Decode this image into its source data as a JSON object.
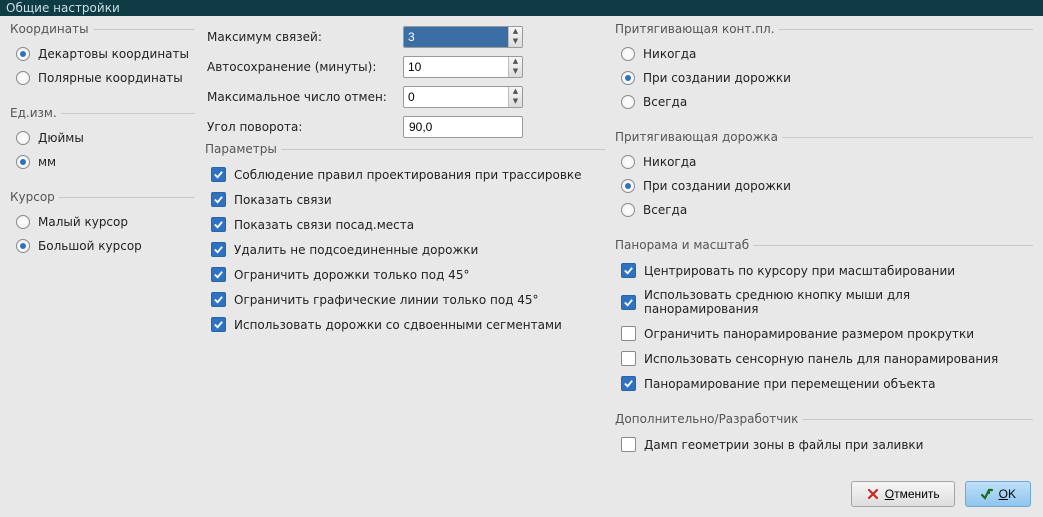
{
  "window": {
    "title": "Общие настройки"
  },
  "coords": {
    "legend": "Координаты",
    "options": [
      {
        "label": "Декартовы координаты",
        "checked": true
      },
      {
        "label": "Полярные координаты",
        "checked": false
      }
    ]
  },
  "units": {
    "legend": "Ед.изм.",
    "options": [
      {
        "label": "Дюймы",
        "checked": false
      },
      {
        "label": "мм",
        "checked": true
      }
    ]
  },
  "cursor": {
    "legend": "Курсор",
    "options": [
      {
        "label": "Малый курсор",
        "checked": false
      },
      {
        "label": "Большой курсор",
        "checked": true
      }
    ]
  },
  "mid": {
    "max_links_label": "Максимум связей:",
    "max_links_value": "3",
    "autosave_label": "Автосохранение (минуты):",
    "autosave_value": "10",
    "max_undo_label": "Максимальное число отмен:",
    "max_undo_value": "0",
    "rotate_label": "Угол поворота:",
    "rotate_value": "90,0"
  },
  "params": {
    "legend": "Параметры",
    "items": [
      {
        "label": "Соблюдение правил проектирования при трассировке",
        "checked": true
      },
      {
        "label": "Показать связи",
        "checked": true
      },
      {
        "label": "Показать связи посад.места",
        "checked": true
      },
      {
        "label": "Удалить не подсоединенные дорожки",
        "checked": true
      },
      {
        "label": "Ограничить дорожки только под 45°",
        "checked": true
      },
      {
        "label": "Ограничить графические линии только под 45°",
        "checked": true
      },
      {
        "label": "Использовать дорожки со сдвоенными сегментами",
        "checked": true
      }
    ]
  },
  "magpad": {
    "legend": "Притягивающая конт.пл.",
    "options": [
      {
        "label": "Никогда",
        "checked": false
      },
      {
        "label": "При создании дорожки",
        "checked": true
      },
      {
        "label": "Всегда",
        "checked": false
      }
    ]
  },
  "magtrack": {
    "legend": "Притягивающая дорожка",
    "options": [
      {
        "label": "Никогда",
        "checked": false
      },
      {
        "label": "При создании дорожки",
        "checked": true
      },
      {
        "label": "Всегда",
        "checked": false
      }
    ]
  },
  "panzoom": {
    "legend": "Панорама и масштаб",
    "items": [
      {
        "label": "Центрировать по курсору при масштабировании",
        "checked": true
      },
      {
        "label": "Использовать среднюю кнопку мыши для панорамирования",
        "checked": true
      },
      {
        "label": "Ограничить панорамирование размером прокрутки",
        "checked": false
      },
      {
        "label": "Использовать сенсорную панель для панорамирования",
        "checked": false
      },
      {
        "label": "Панорамирование при перемещении объекта",
        "checked": true
      }
    ]
  },
  "extra": {
    "legend": "Дополнительно/Разработчик",
    "items": [
      {
        "label": "Дамп геометрии зоны в файлы при заливки",
        "checked": false
      }
    ]
  },
  "buttons": {
    "cancel": "Отменить",
    "ok": "OK"
  }
}
